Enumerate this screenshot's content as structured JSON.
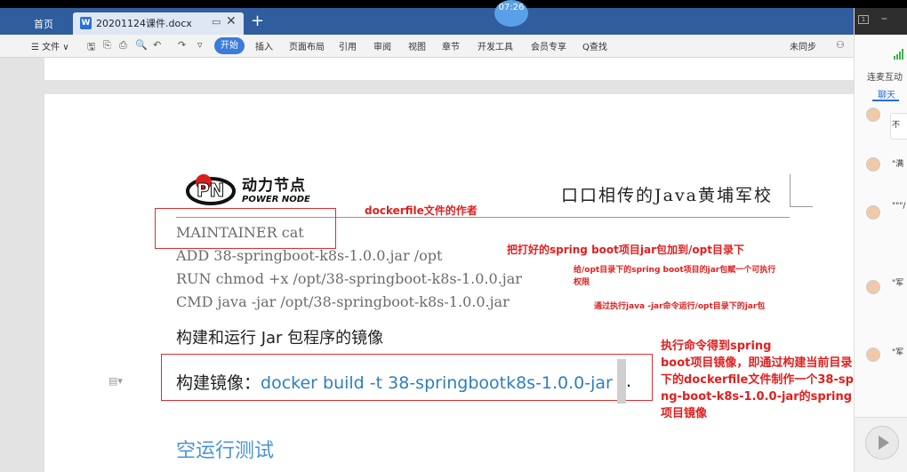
{
  "tabs": {
    "home": "首页",
    "doc_title": "20201124课件.docx",
    "doc_icon": "W",
    "close": "✕",
    "new_tab": "+",
    "time_badge": "07:26"
  },
  "toolbar": {
    "menu_file": "☰ 文件 ∨",
    "start": "开始",
    "insert": "插入",
    "layout": "页面布局",
    "references": "引用",
    "review": "审阅",
    "view": "视图",
    "section": "章节",
    "developer": "开发工具",
    "member": "会员专享",
    "search": "Q查找",
    "sync": "未同步"
  },
  "document": {
    "logo_cn": "动力节点",
    "logo_en": "POWER NODE",
    "slogan": "口口相传的Java黄埔军校",
    "code_lines": [
      "MAINTAINER cat",
      "ADD 38-springboot-k8s-1.0.0.jar /opt",
      "RUN chmod +x /opt/38-springboot-k8s-1.0.0.jar",
      "CMD java -jar /opt/38-springboot-k8s-1.0.0.jar"
    ],
    "heading": "构建和运行 Jar 包程序的镜像",
    "cmd_label": "构建镜像：",
    "cmd_keyword": "docker build -t",
    "cmd_arg": "38-springbootk8s-1.0.0-jar",
    "cmd_dot": ".",
    "subheading": "空运行测试"
  },
  "annotations": {
    "author": "dockerfile文件的作者",
    "add": "把打好的spring boot项目jar包加到/opt目录下",
    "chmod_line1": "给/opt目录下的spring boot项目的jar包赋一个可执行",
    "chmod_line2": "权限",
    "cmd": "通过执行java -jar命令运行/opt目录下的jar包",
    "build_lines": [
      "执行命令得到spring",
      "boot项目镜像，即通过构建当前目录",
      "下的dockerfile文件制作一个38-spri",
      "ng-boot-k8s-1.0.0-jar的spring boot",
      "项目镜像"
    ]
  },
  "right_panel": {
    "tab_interact": "连麦互动",
    "tab_chat": "聊天",
    "messages": [
      "不",
      "\"满",
      "\"\"\"/",
      "\"军",
      "\"军"
    ]
  },
  "colors": {
    "annotation_red": "#e02020",
    "command_blue": "#2d7fc0",
    "tab_bar": "#2f5d9e"
  }
}
